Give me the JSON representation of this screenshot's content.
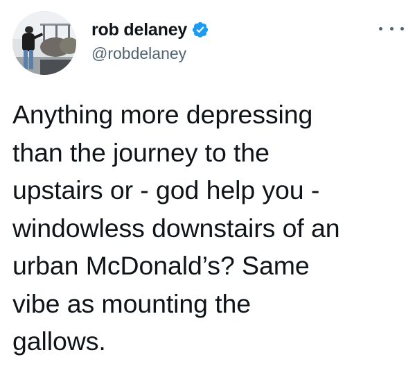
{
  "user": {
    "display_name": "rob delaney",
    "handle": "@robdelaney",
    "verified": true
  },
  "icons": {
    "verified": "verified-badge-icon",
    "more": "more-options-icon"
  },
  "colors": {
    "verified_blue": "#1d9bf0",
    "text": "#0f1419",
    "secondary": "#536471"
  },
  "tweet": {
    "lines": [
      "Anything more depressing",
      "than the journey to the",
      "upstairs or - god help you -",
      "windowless downstairs of an",
      "urban McDonald’s? Same",
      "vibe as mounting the",
      "gallows."
    ]
  }
}
